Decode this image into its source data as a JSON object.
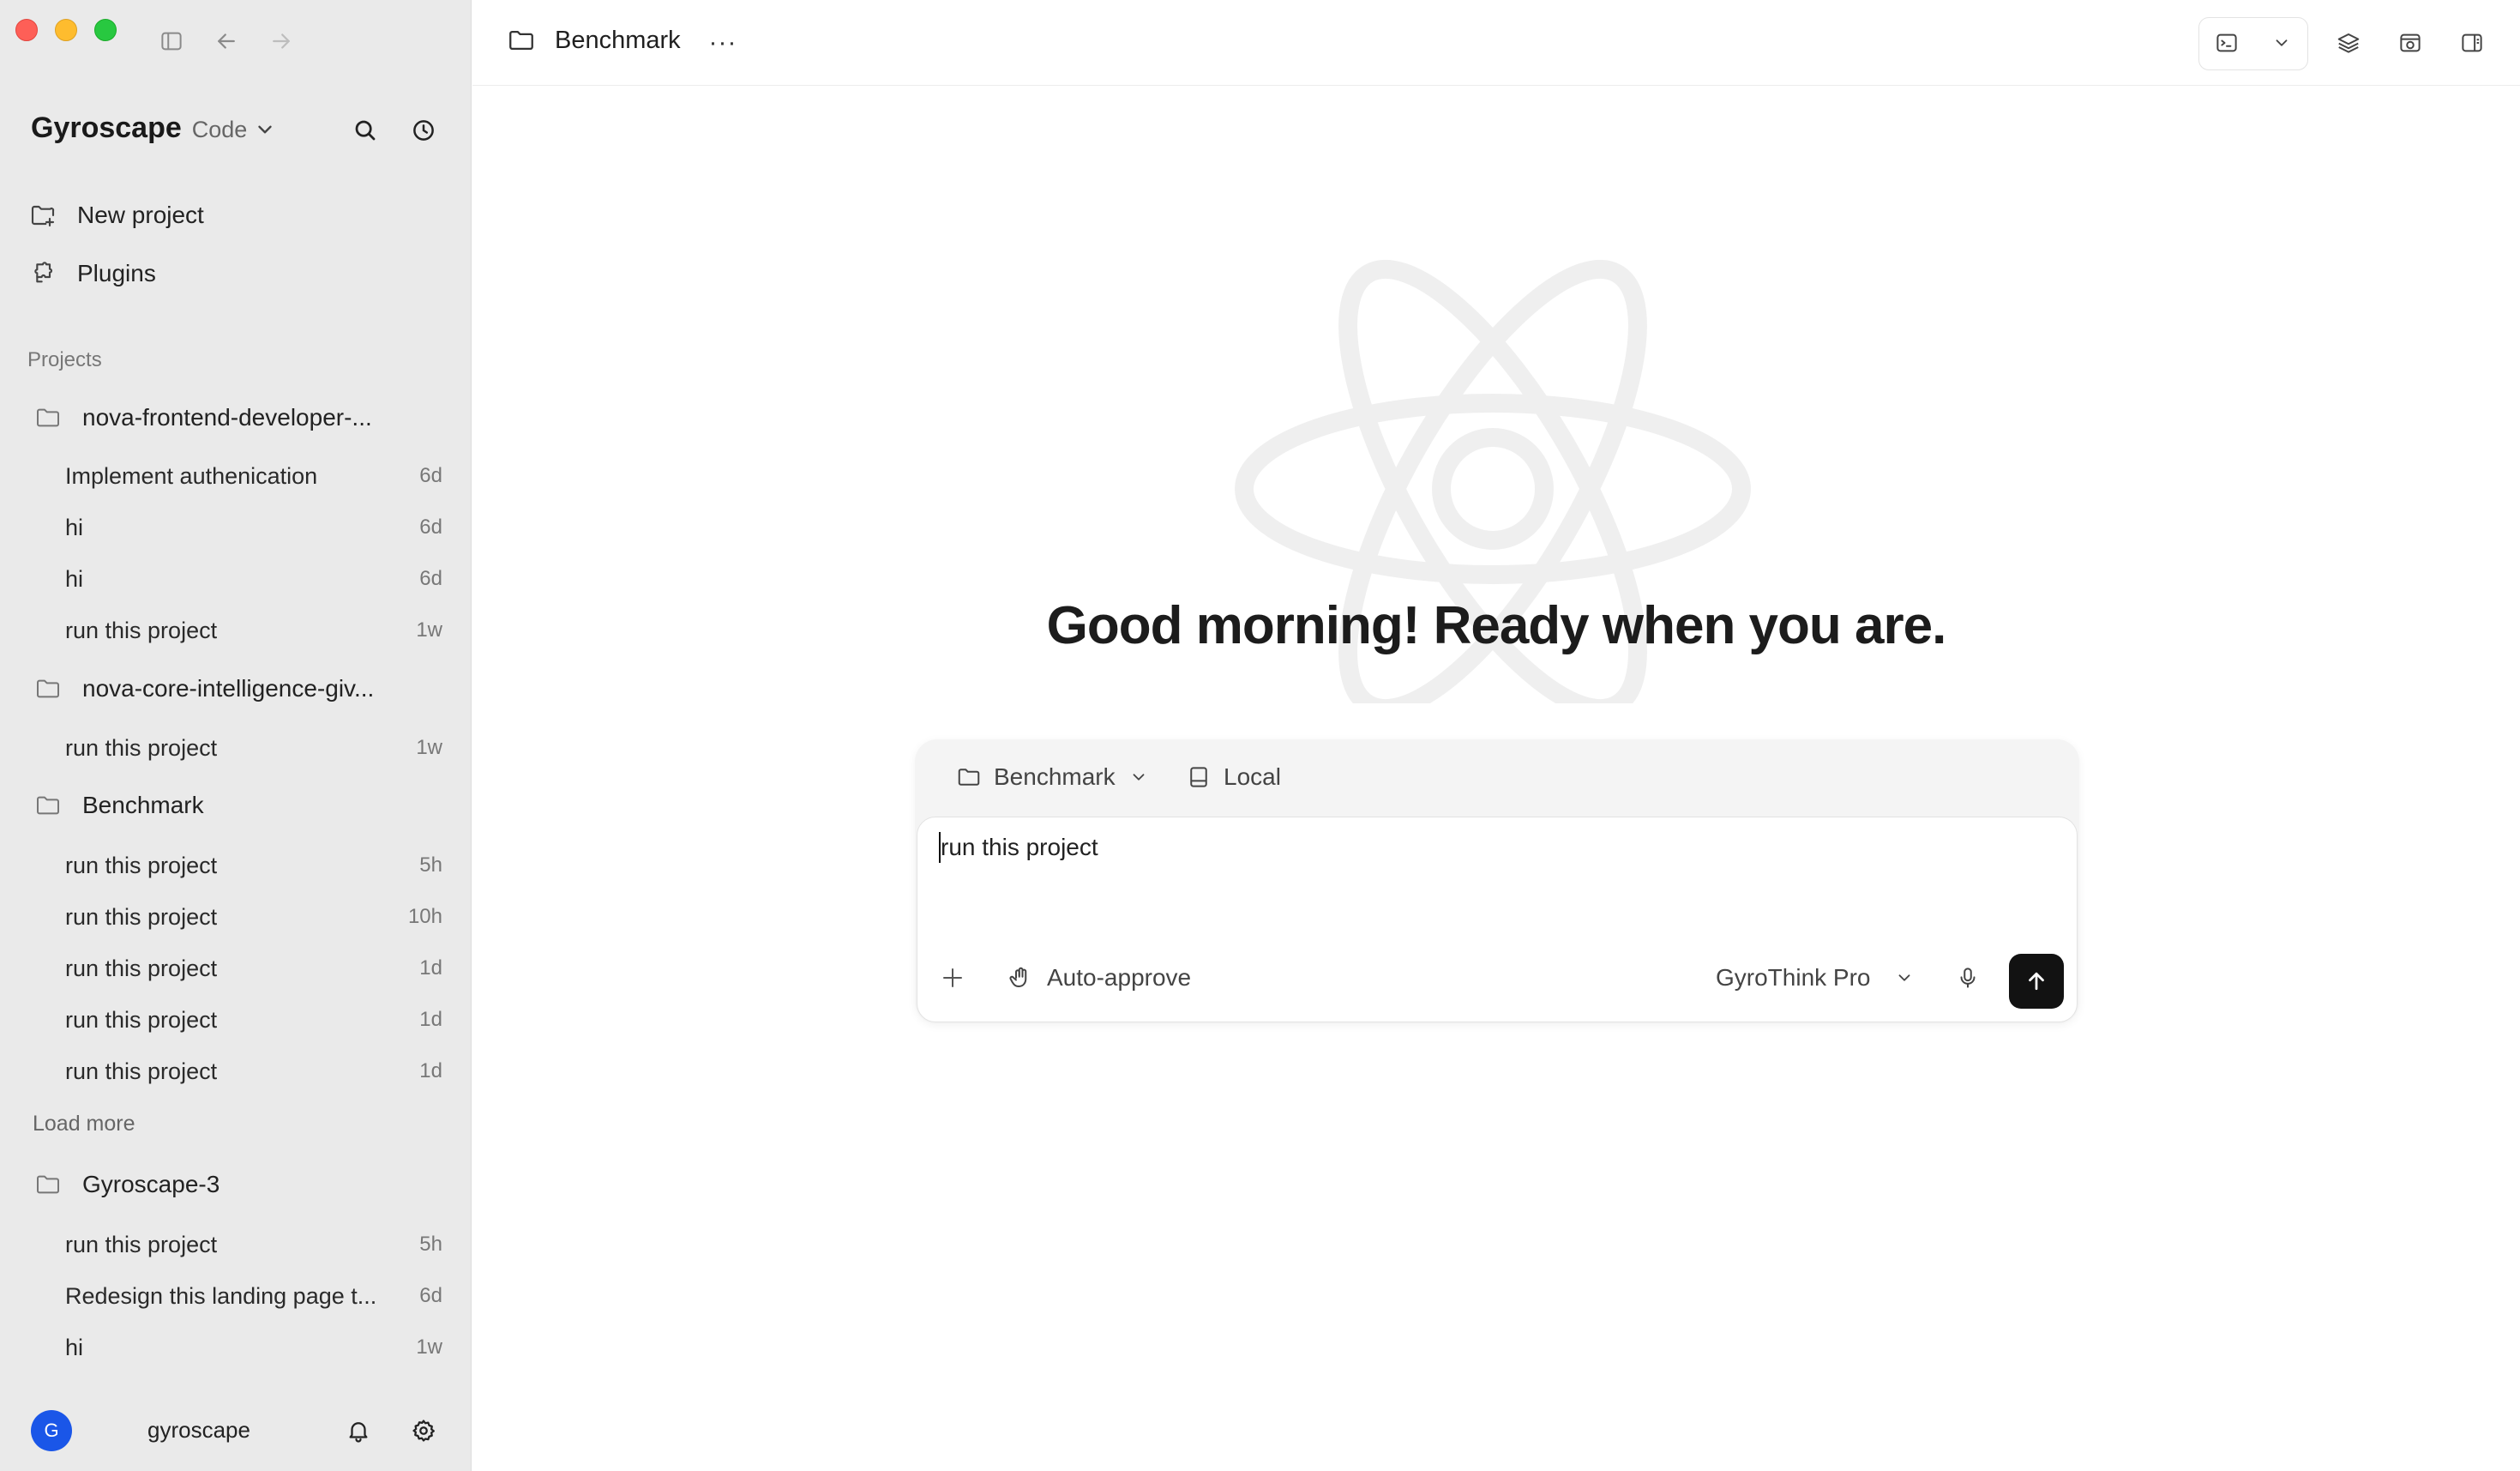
{
  "sidebar": {
    "brand": {
      "name": "Gyroscape",
      "mode": "Code"
    },
    "nav": [
      {
        "label": "New project",
        "icon": "new-project-icon"
      },
      {
        "label": "Plugins",
        "icon": "plugins-icon"
      }
    ],
    "projects_label": "Projects",
    "projects": [
      {
        "name": "nova-frontend-developer-...",
        "threads": [
          {
            "title": "Implement authenication",
            "time": "6d"
          },
          {
            "title": "hi",
            "time": "6d"
          },
          {
            "title": "hi",
            "time": "6d"
          },
          {
            "title": "run this project",
            "time": "1w"
          }
        ]
      },
      {
        "name": "nova-core-intelligence-giv...",
        "threads": [
          {
            "title": "run this project",
            "time": "1w"
          }
        ]
      },
      {
        "name": "Benchmark",
        "threads": [
          {
            "title": "run this project",
            "time": "5h"
          },
          {
            "title": "run this project",
            "time": "10h"
          },
          {
            "title": "run this project",
            "time": "1d"
          },
          {
            "title": "run this project",
            "time": "1d"
          },
          {
            "title": "run this project",
            "time": "1d"
          }
        ],
        "load_more": "Load more"
      },
      {
        "name": "Gyroscape-3",
        "threads": [
          {
            "title": "run this project",
            "time": "5h"
          },
          {
            "title": "Redesign this landing page t...",
            "time": "6d"
          },
          {
            "title": "hi",
            "time": "1w"
          }
        ]
      }
    ],
    "user": {
      "initial": "G",
      "name": "gyroscape"
    }
  },
  "topbar": {
    "breadcrumb": "Benchmark",
    "more": "···"
  },
  "main": {
    "greeting": "Good morning! Ready when you are.",
    "composer": {
      "project": "Benchmark",
      "environment": "Local",
      "input_value": "run this project",
      "auto_approve": "Auto-approve",
      "model": "GyroThink Pro"
    }
  },
  "colors": {
    "sidebar_bg": "#eaeaea",
    "accent_avatar": "#1a56e8",
    "send_button": "#121212"
  }
}
